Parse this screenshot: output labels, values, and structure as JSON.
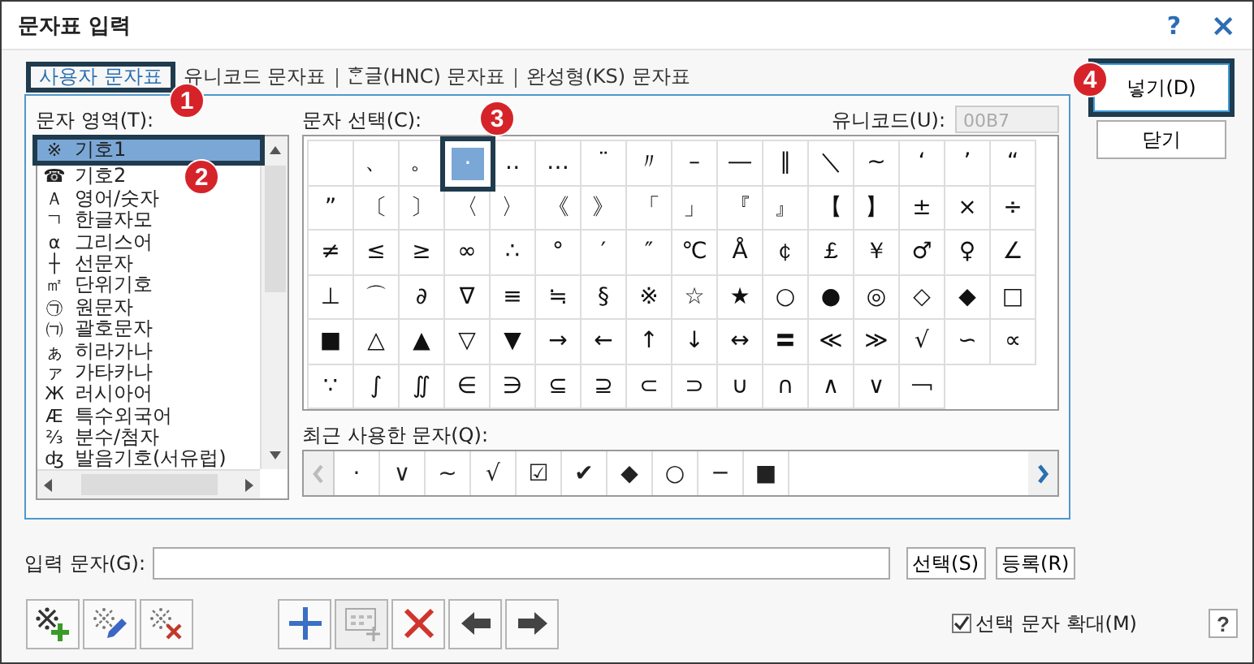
{
  "window": {
    "title": "문자표 입력",
    "help_label": "?",
    "close_label": "×"
  },
  "tabs": [
    {
      "label": "사용자 문자표",
      "selected": true
    },
    {
      "label": "유니코드 문자표",
      "selected": false
    },
    {
      "label": "ᄒᆞᆫ글(HNC) 문자표",
      "selected": false
    },
    {
      "label": "완성형(KS) 문자표",
      "selected": false
    }
  ],
  "category_list": {
    "label": "문자 영역(T):",
    "items": [
      {
        "glyph": "※",
        "label": "기호1",
        "selected": true
      },
      {
        "glyph": "☎",
        "label": "기호2",
        "selected": false
      },
      {
        "glyph": "Ａ",
        "label": "영어/숫자",
        "selected": false
      },
      {
        "glyph": "ㄱ",
        "label": "한글자모",
        "selected": false
      },
      {
        "glyph": "α",
        "label": "그리스어",
        "selected": false
      },
      {
        "glyph": "┼",
        "label": "선문자",
        "selected": false
      },
      {
        "glyph": "㎡",
        "label": "단위기호",
        "selected": false
      },
      {
        "glyph": "㉠",
        "label": "원문자",
        "selected": false
      },
      {
        "glyph": "㈀",
        "label": "괄호문자",
        "selected": false
      },
      {
        "glyph": "ぁ",
        "label": "히라가나",
        "selected": false
      },
      {
        "glyph": "ァ",
        "label": "가타카나",
        "selected": false
      },
      {
        "glyph": "Ж",
        "label": "러시아어",
        "selected": false
      },
      {
        "glyph": "Æ",
        "label": "특수외국어",
        "selected": false
      },
      {
        "glyph": "⅔",
        "label": "분수/첨자",
        "selected": false
      },
      {
        "glyph": "ʤ",
        "label": "발음기호(서유럽)",
        "selected": false
      }
    ]
  },
  "char_grid": {
    "label": "문자 선택(C):",
    "unicode_label": "유니코드(U):",
    "unicode_value": "00B7",
    "rows": [
      [
        {
          "selected": false
        },
        {
          "c": "、",
          "selected": false
        },
        {
          "c": "。",
          "selected": false
        },
        {
          "c": "·",
          "selected": true
        },
        {
          "c": "‥",
          "selected": false
        },
        {
          "c": "…",
          "selected": false
        },
        {
          "c": "¨",
          "selected": false
        },
        {
          "c": "〃",
          "selected": false
        },
        {
          "c": "–",
          "selected": false
        },
        {
          "c": "―",
          "selected": false
        },
        {
          "c": "∥",
          "selected": false
        },
        {
          "c": "＼",
          "selected": false
        },
        {
          "c": "∼",
          "selected": false
        },
        {
          "c": "‘",
          "selected": false
        },
        {
          "c": "’",
          "selected": false
        },
        {
          "c": "“",
          "selected": false
        }
      ],
      [
        {
          "c": "”",
          "selected": false
        },
        {
          "c": "〔",
          "selected": false
        },
        {
          "c": "〕",
          "selected": false
        },
        {
          "c": "〈",
          "selected": false
        },
        {
          "c": "〉",
          "selected": false
        },
        {
          "c": "《",
          "selected": false
        },
        {
          "c": "》",
          "selected": false
        },
        {
          "c": "「",
          "selected": false
        },
        {
          "c": "」",
          "selected": false
        },
        {
          "c": "『",
          "selected": false
        },
        {
          "c": "』",
          "selected": false
        },
        {
          "c": "【",
          "selected": false
        },
        {
          "c": "】",
          "selected": false
        },
        {
          "c": "±",
          "selected": false
        },
        {
          "c": "×",
          "selected": false
        },
        {
          "c": "÷",
          "selected": false
        }
      ],
      [
        {
          "c": "≠",
          "selected": false
        },
        {
          "c": "≤",
          "selected": false
        },
        {
          "c": "≥",
          "selected": false
        },
        {
          "c": "∞",
          "selected": false
        },
        {
          "c": "∴",
          "selected": false
        },
        {
          "c": "°",
          "selected": false
        },
        {
          "c": "′",
          "selected": false
        },
        {
          "c": "″",
          "selected": false
        },
        {
          "c": "℃",
          "selected": false
        },
        {
          "c": "Å",
          "selected": false
        },
        {
          "c": "￠",
          "selected": false
        },
        {
          "c": "￡",
          "selected": false
        },
        {
          "c": "￥",
          "selected": false
        },
        {
          "c": "♂",
          "selected": false
        },
        {
          "c": "♀",
          "selected": false
        },
        {
          "c": "∠",
          "selected": false
        }
      ],
      [
        {
          "c": "⊥",
          "selected": false
        },
        {
          "c": "⌒",
          "selected": false
        },
        {
          "c": "∂",
          "selected": false
        },
        {
          "c": "∇",
          "selected": false
        },
        {
          "c": "≡",
          "selected": false
        },
        {
          "c": "≒",
          "selected": false
        },
        {
          "c": "§",
          "selected": false
        },
        {
          "c": "※",
          "selected": false
        },
        {
          "c": "☆",
          "selected": false
        },
        {
          "c": "★",
          "selected": false
        },
        {
          "c": "○",
          "selected": false
        },
        {
          "c": "●",
          "selected": false
        },
        {
          "c": "◎",
          "selected": false
        },
        {
          "c": "◇",
          "selected": false
        },
        {
          "c": "◆",
          "selected": false
        },
        {
          "c": "□",
          "selected": false
        }
      ],
      [
        {
          "c": "■",
          "selected": false
        },
        {
          "c": "△",
          "selected": false
        },
        {
          "c": "▲",
          "selected": false
        },
        {
          "c": "▽",
          "selected": false
        },
        {
          "c": "▼",
          "selected": false
        },
        {
          "c": "→",
          "selected": false
        },
        {
          "c": "←",
          "selected": false
        },
        {
          "c": "↑",
          "selected": false
        },
        {
          "c": "↓",
          "selected": false
        },
        {
          "c": "↔",
          "selected": false
        },
        {
          "c": "〓",
          "selected": false
        },
        {
          "c": "≪",
          "selected": false
        },
        {
          "c": "≫",
          "selected": false
        },
        {
          "c": "√",
          "selected": false
        },
        {
          "c": "∽",
          "selected": false
        },
        {
          "c": "∝",
          "selected": false
        }
      ],
      [
        {
          "c": "∵",
          "selected": false
        },
        {
          "c": "∫",
          "selected": false
        },
        {
          "c": "∬",
          "selected": false
        },
        {
          "c": "∈",
          "selected": false
        },
        {
          "c": "∋",
          "selected": false
        },
        {
          "c": "⊆",
          "selected": false
        },
        {
          "c": "⊇",
          "selected": false
        },
        {
          "c": "⊂",
          "selected": false
        },
        {
          "c": "⊃",
          "selected": false
        },
        {
          "c": "∪",
          "selected": false
        },
        {
          "c": "∩",
          "selected": false
        },
        {
          "c": "∧",
          "selected": false
        },
        {
          "c": "∨",
          "selected": false
        },
        {
          "c": "￢",
          "selected": false
        }
      ]
    ]
  },
  "recent": {
    "label": "최근 사용한 문자(Q):",
    "chars": [
      "·",
      "∨",
      "~",
      "√",
      "☑",
      "✔",
      "◆",
      "○",
      "─",
      "■"
    ]
  },
  "input": {
    "label": "입력 문자(G):",
    "buttons": [
      "선택(S)",
      "등록(R)"
    ]
  },
  "toolbar": [
    {
      "kind": "set-add",
      "disabled": false
    },
    {
      "kind": "set-edit",
      "disabled": false
    },
    {
      "kind": "set-delete",
      "disabled": false
    },
    {
      "kind": "plus",
      "disabled": false
    },
    {
      "kind": "grid-add",
      "disabled": true
    },
    {
      "kind": "delete",
      "disabled": false
    },
    {
      "kind": "left",
      "disabled": false
    },
    {
      "kind": "right",
      "disabled": false
    }
  ],
  "zoom_option": {
    "label": "선택 문자 확대(M)",
    "checked": true
  },
  "side_buttons": [
    {
      "label": "넣기(D)",
      "default": true
    },
    {
      "label": "닫기",
      "default": false
    }
  ],
  "footer_help": "?",
  "callouts": [
    {
      "number": "1"
    },
    {
      "number": "2"
    },
    {
      "number": "3"
    },
    {
      "number": "4"
    }
  ]
}
